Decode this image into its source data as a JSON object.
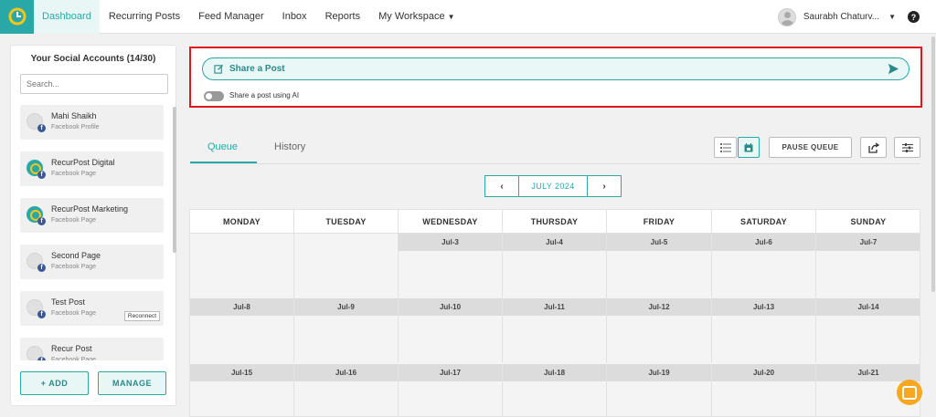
{
  "nav": {
    "items": [
      "Dashboard",
      "Recurring Posts",
      "Feed Manager",
      "Inbox",
      "Reports",
      "My Workspace"
    ],
    "user_name": "Saurabh Chaturv...",
    "help": "?"
  },
  "sidebar": {
    "title": "Your Social Accounts (14/30)",
    "search_placeholder": "Search...",
    "accounts": [
      {
        "name": "Mahi Shaikh",
        "type": "Facebook Profile"
      },
      {
        "name": "RecurPost Digital",
        "type": "Facebook Page"
      },
      {
        "name": "RecurPost Marketing",
        "type": "Facebook Page"
      },
      {
        "name": "Second Page",
        "type": "Facebook Page"
      },
      {
        "name": "Test Post",
        "type": "Facebook Page",
        "action": "Reconnect"
      },
      {
        "name": "Recur Post",
        "type": "Facebook Page"
      }
    ],
    "add_label": "+ ADD",
    "manage_label": "MANAGE"
  },
  "share": {
    "label": "Share a Post",
    "ai_label": "Share a post using AI"
  },
  "tabs": [
    "Queue",
    "History"
  ],
  "toolbar": {
    "pause_label": "PAUSE QUEUE"
  },
  "calendar": {
    "month": "JULY 2024",
    "days": [
      "MONDAY",
      "TUESDAY",
      "WEDNESDAY",
      "THURSDAY",
      "FRIDAY",
      "SATURDAY",
      "SUNDAY"
    ],
    "weeks": [
      [
        "",
        "",
        "Jul-3",
        "Jul-4",
        "Jul-5",
        "Jul-6",
        "Jul-7"
      ],
      [
        "Jul-8",
        "Jul-9",
        "Jul-10",
        "Jul-11",
        "Jul-12",
        "Jul-13",
        "Jul-14"
      ],
      [
        "Jul-15",
        "Jul-16",
        "Jul-17",
        "Jul-18",
        "Jul-19",
        "Jul-20",
        "Jul-21"
      ]
    ]
  },
  "colors": {
    "accent": "#2aa8a8",
    "highlight": "#e0161d",
    "facebook": "#3b5998",
    "chat": "#f7a823"
  },
  "icons": [
    "logo-icon",
    "edit-icon",
    "send-icon",
    "list-view-icon",
    "calendar-view-icon",
    "share-icon",
    "filter-icon",
    "chat-icon"
  ]
}
